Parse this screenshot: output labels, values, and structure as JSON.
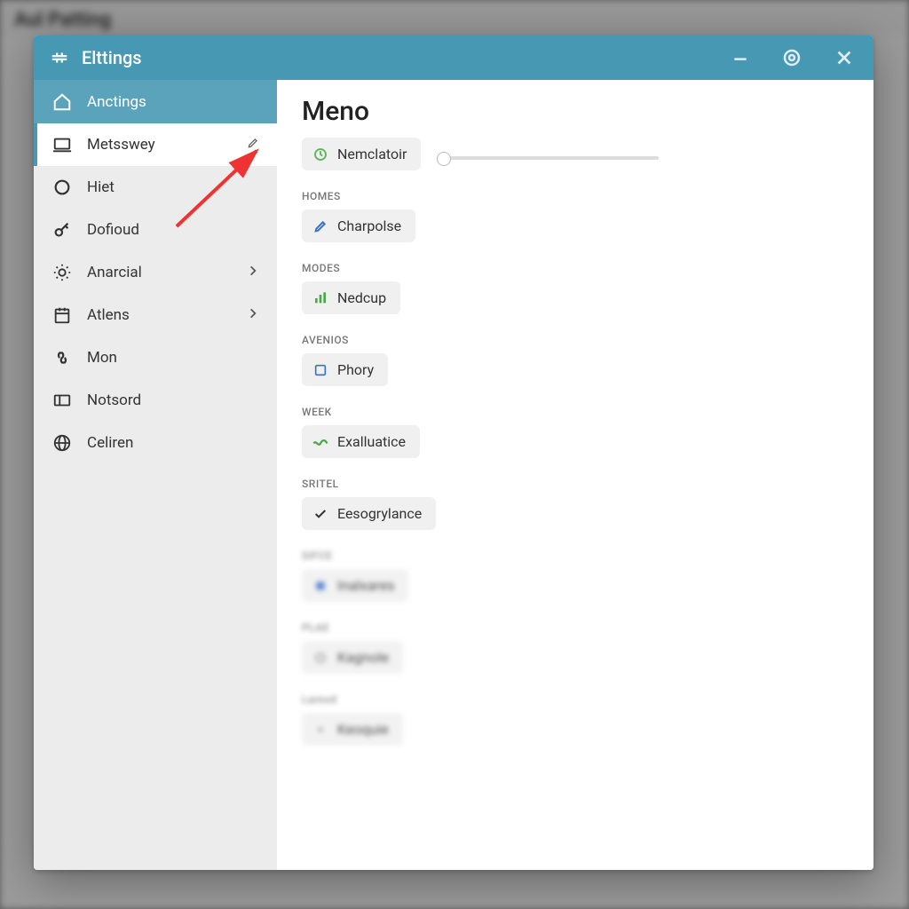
{
  "colors": {
    "accent": "#4798b3"
  },
  "background": {
    "title": "Aul Patting"
  },
  "window": {
    "title": "Elttings",
    "minimize": "—",
    "gear": "⚙",
    "close": "✕"
  },
  "sidebar": {
    "items": [
      {
        "label": "Anctings",
        "icon": "home-icon"
      },
      {
        "label": "Metsswey",
        "icon": "laptop-icon",
        "trailing": "edit"
      },
      {
        "label": "Hiet",
        "icon": "circle-icon"
      },
      {
        "label": "Dofioud",
        "icon": "key-icon"
      },
      {
        "label": "Anarcial",
        "icon": "brightness-icon",
        "trailing": "chevron"
      },
      {
        "label": "Atlens",
        "icon": "calendar-icon",
        "trailing": "chevron"
      },
      {
        "label": "Mon",
        "icon": "link-icon"
      },
      {
        "label": "Notsord",
        "icon": "panel-icon"
      },
      {
        "label": "Celiren",
        "icon": "globe-icon"
      }
    ]
  },
  "main": {
    "heading": "Meno",
    "top_chip": "Nemclatoir",
    "sections": [
      {
        "label": "HOMES",
        "chip": "Charpolse",
        "icon": "edit-sq"
      },
      {
        "label": "MODES",
        "chip": "Nedcup",
        "icon": "bar"
      },
      {
        "label": "AVENIOS",
        "chip": "Phory",
        "icon": "square"
      },
      {
        "label": "WEEK",
        "chip": "Exalluatice",
        "icon": "wave"
      },
      {
        "label": "SRITEL",
        "chip": "Eesogrylance",
        "icon": "check"
      },
      {
        "label": "SIFCE",
        "chip": "Inalxares",
        "icon": "box-blue",
        "blurred": true
      },
      {
        "label": "PLAE",
        "chip": "Kagnole",
        "icon": "radio",
        "blurred": true
      },
      {
        "label": "Lamod",
        "chip": "Keoquie",
        "icon": "dot",
        "blurred": true
      }
    ]
  }
}
